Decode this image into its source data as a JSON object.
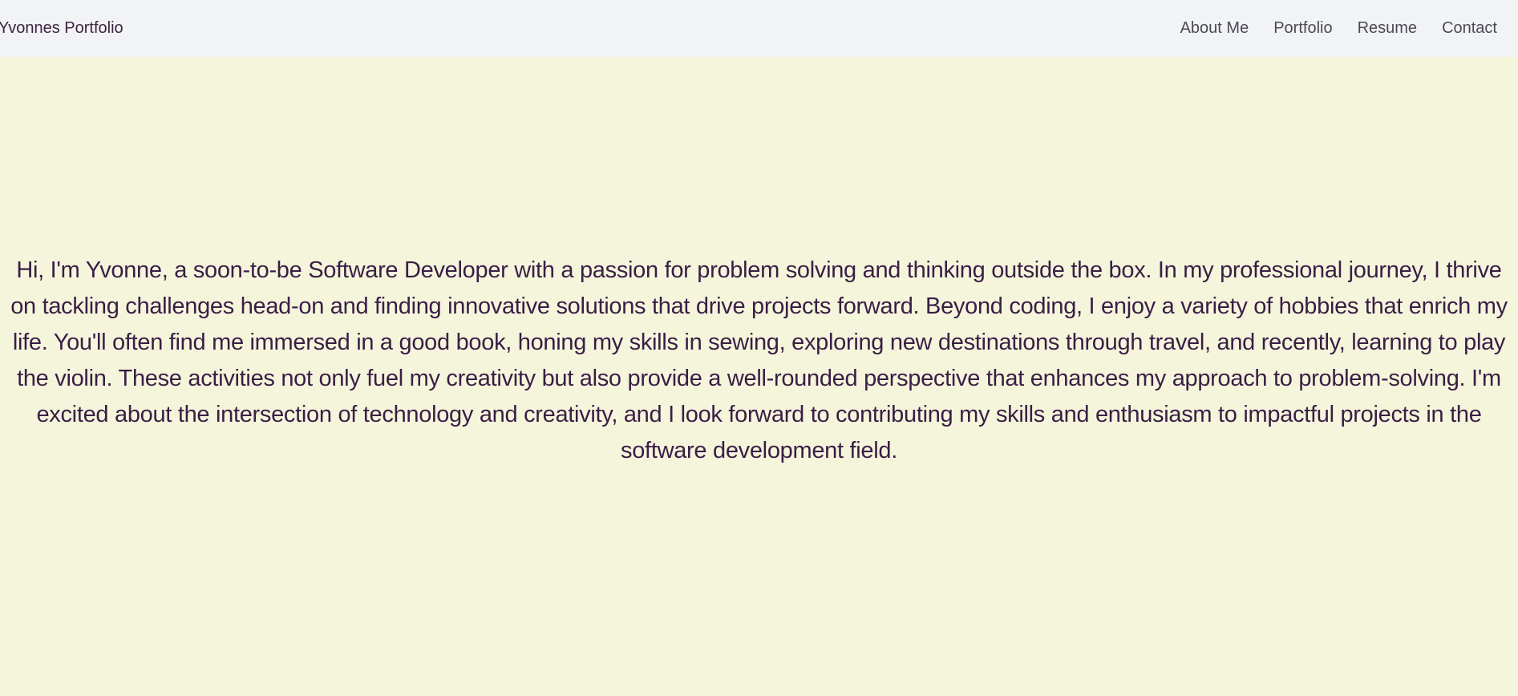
{
  "navbar": {
    "brand": "Yvonnes Portfolio",
    "links": [
      {
        "label": "About Me"
      },
      {
        "label": "Portfolio"
      },
      {
        "label": "Resume"
      },
      {
        "label": "Contact"
      }
    ]
  },
  "about": {
    "bio": "Hi, I'm Yvonne, a soon-to-be Software Developer with a passion for problem solving and thinking outside the box. In my professional journey, I thrive on tackling challenges head-on and finding innovative solutions that drive projects forward. Beyond coding, I enjoy a variety of hobbies that enrich my life. You'll often find me immersed in a good book, honing my skills in sewing, exploring new destinations through travel, and recently, learning to play the violin. These activities not only fuel my creativity but also provide a well-rounded perspective that enhances my approach to problem-solving. I'm excited about the intersection of technology and creativity, and I look forward to contributing my skills and enthusiasm to impactful projects in the software development field."
  },
  "colors": {
    "page_background": "#f5f5dc",
    "navbar_background": "#f2f3f5",
    "text": "#3a1e45",
    "nav_link": "#4a4a55"
  }
}
